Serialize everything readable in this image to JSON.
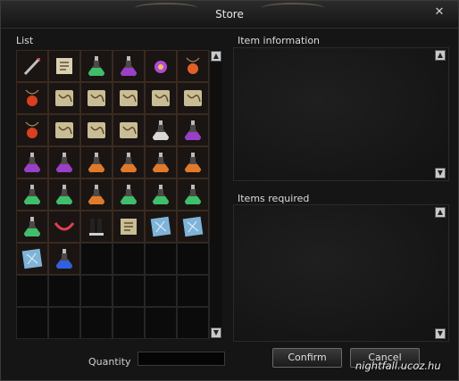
{
  "window": {
    "title": "Store",
    "close_glyph": "✕"
  },
  "list": {
    "label": "List",
    "columns": 6,
    "total_slots": 54,
    "items": [
      {
        "icon": "spear-icon",
        "color": "#c0c0c0"
      },
      {
        "icon": "scroll-icon",
        "color": "#d8d0b0"
      },
      {
        "icon": "potion-icon",
        "color": "#3fbf6a"
      },
      {
        "icon": "potion-icon",
        "color": "#9a3fc8"
      },
      {
        "icon": "charm-icon",
        "color": "#b04ad0"
      },
      {
        "icon": "amulet-icon",
        "color": "#e0602a"
      },
      {
        "icon": "amulet-icon",
        "color": "#d84020"
      },
      {
        "icon": "map-icon",
        "color": "#c9bd96"
      },
      {
        "icon": "map-icon",
        "color": "#c9bd96"
      },
      {
        "icon": "map-icon",
        "color": "#c9bd96"
      },
      {
        "icon": "map-icon",
        "color": "#c9bd96"
      },
      {
        "icon": "map-icon",
        "color": "#c9bd96"
      },
      {
        "icon": "amulet-icon",
        "color": "#d84020"
      },
      {
        "icon": "map-icon",
        "color": "#c9bd96"
      },
      {
        "icon": "map-icon",
        "color": "#c9bd96"
      },
      {
        "icon": "map-icon",
        "color": "#c9bd96"
      },
      {
        "icon": "potion-icon",
        "color": "#d8d8d8"
      },
      {
        "icon": "potion-icon",
        "color": "#9a3fc8"
      },
      {
        "icon": "potion-icon",
        "color": "#9a3fc8"
      },
      {
        "icon": "potion-icon",
        "color": "#9a3fc8"
      },
      {
        "icon": "potion-icon",
        "color": "#e07a2a"
      },
      {
        "icon": "potion-icon",
        "color": "#e07a2a"
      },
      {
        "icon": "potion-icon",
        "color": "#e07a2a"
      },
      {
        "icon": "potion-icon",
        "color": "#e07a2a"
      },
      {
        "icon": "potion-icon",
        "color": "#3fbf6a"
      },
      {
        "icon": "potion-icon",
        "color": "#3fbf6a"
      },
      {
        "icon": "potion-icon",
        "color": "#e07a2a"
      },
      {
        "icon": "potion-icon",
        "color": "#3fbf6a"
      },
      {
        "icon": "potion-icon",
        "color": "#3fbf6a"
      },
      {
        "icon": "potion-icon",
        "color": "#3fbf6a"
      },
      {
        "icon": "potion-icon",
        "color": "#3fbf6a"
      },
      {
        "icon": "bow-icon",
        "color": "#e04050"
      },
      {
        "icon": "boots-icon",
        "color": "#2a5a48"
      },
      {
        "icon": "scroll-icon",
        "color": "#c9bd96"
      },
      {
        "icon": "parchment-icon",
        "color": "#7fb4d8"
      },
      {
        "icon": "parchment-icon",
        "color": "#7fb4d8"
      },
      {
        "icon": "parchment-icon",
        "color": "#7fb4d8"
      },
      {
        "icon": "potion-icon",
        "color": "#3060e0"
      }
    ]
  },
  "item_information": {
    "label": "Item information"
  },
  "items_required": {
    "label": "Items required"
  },
  "quantity": {
    "label": "Quantity",
    "value": ""
  },
  "buttons": {
    "confirm": "Confirm",
    "cancel": "Cancel"
  },
  "watermark": "nightfall.ucoz.hu",
  "scroll_glyphs": {
    "up": "▲",
    "down": "▼"
  }
}
